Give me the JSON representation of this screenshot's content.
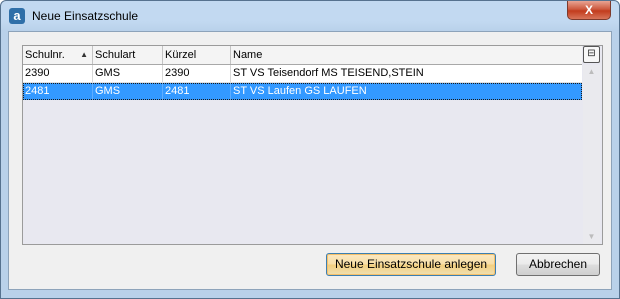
{
  "window": {
    "title": "Neue Einsatzschule",
    "app_icon_letter": "a",
    "close_symbol": "X"
  },
  "grid": {
    "columns": [
      "Schulnr.",
      "Schulart",
      "Kürzel",
      "Name"
    ],
    "sort_indicator": "▲",
    "column_chooser_symbol": "⊟",
    "rows": [
      {
        "schulnr": "2390",
        "schulart": "GMS",
        "kuerzel": "2390",
        "name": "ST VS Teisendorf MS TEISEND,STEIN",
        "selected": false
      },
      {
        "schulnr": "2481",
        "schulart": "GMS",
        "kuerzel": "2481",
        "name": "ST VS Laufen GS LAUFEN",
        "selected": true
      }
    ],
    "scroll_up": "▲",
    "scroll_down": "▼"
  },
  "buttons": {
    "create": "Neue Einsatzschule anlegen",
    "cancel": "Abbrechen"
  }
}
